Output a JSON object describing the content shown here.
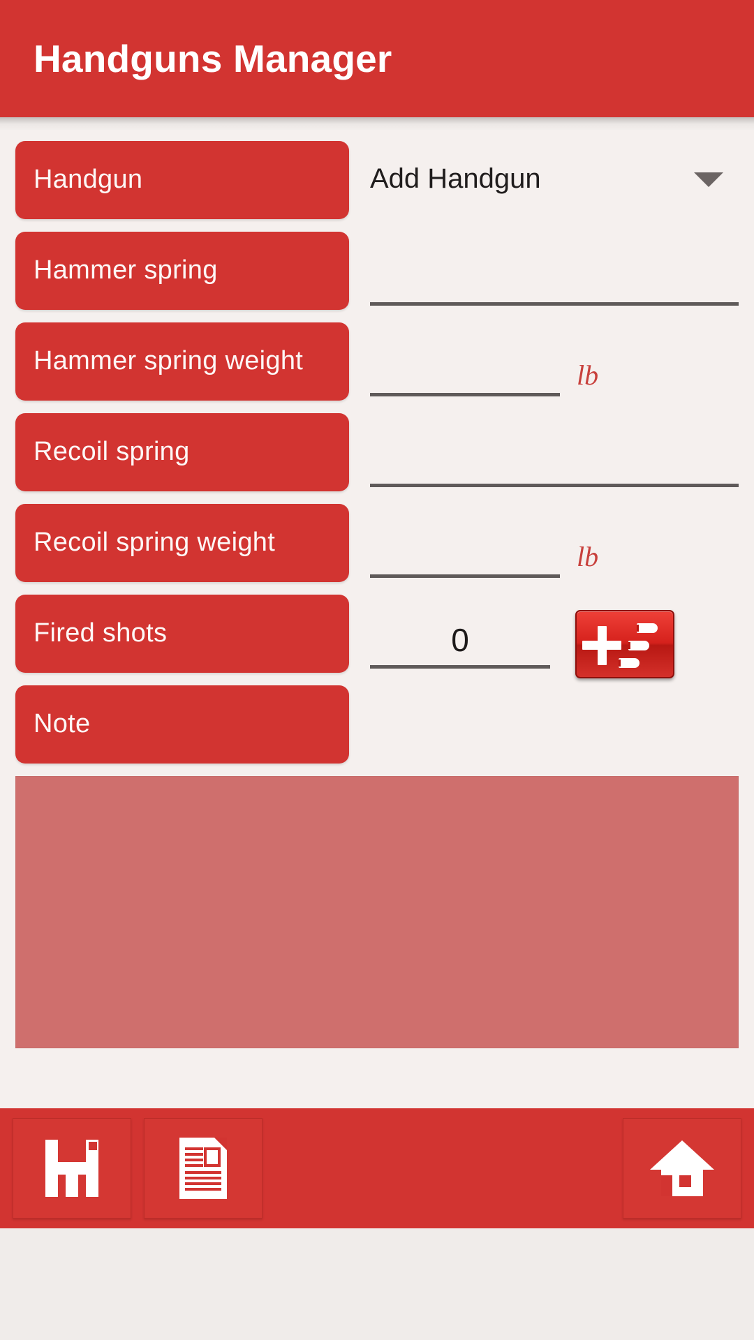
{
  "app": {
    "title": "Handguns Manager",
    "accent_color": "#d23431",
    "background_color": "#f5f0ee",
    "note_color": "#cf6f6d",
    "underline_color": "#5f5a59",
    "unit_color": "#c8403c"
  },
  "form": {
    "rows": [
      {
        "label": "Handgun",
        "type": "dropdown",
        "value": "Add Handgun",
        "icon": "chevron-down-icon"
      },
      {
        "label": "Hammer spring",
        "type": "text",
        "value": ""
      },
      {
        "label": "Hammer spring weight",
        "type": "weight",
        "value": "",
        "unit": "lb"
      },
      {
        "label": "Recoil spring",
        "type": "text",
        "value": ""
      },
      {
        "label": "Recoil spring weight",
        "type": "weight",
        "value": "",
        "unit": "lb"
      },
      {
        "label": "Fired shots",
        "type": "counter",
        "value": "0",
        "button_icon": "add-rounds-icon"
      },
      {
        "label": "Note",
        "type": "textarea",
        "value": ""
      }
    ]
  },
  "toolbar": {
    "buttons": [
      {
        "name": "save-button",
        "icon": "floppy-disk-icon"
      },
      {
        "name": "report-button",
        "icon": "document-icon"
      },
      {
        "name": "home-button",
        "icon": "home-icon"
      }
    ]
  }
}
